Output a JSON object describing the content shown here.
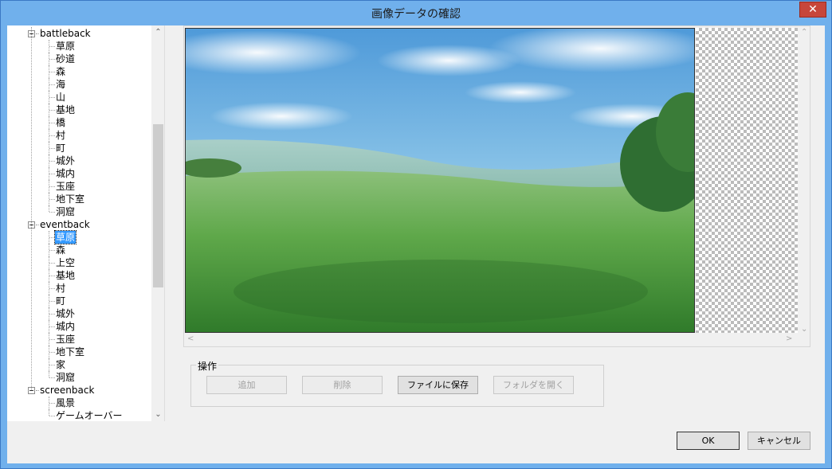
{
  "window": {
    "title": "画像データの確認",
    "close_glyph": "✕"
  },
  "tree": {
    "groups": [
      {
        "label": "battleback",
        "children": [
          "草原",
          "砂道",
          "森",
          "海",
          "山",
          "基地",
          "橋",
          "村",
          "町",
          "城外",
          "城内",
          "玉座",
          "地下室",
          "洞窟"
        ]
      },
      {
        "label": "eventback",
        "children": [
          "草原",
          "森",
          "上空",
          "基地",
          "村",
          "町",
          "城外",
          "城内",
          "玉座",
          "地下室",
          "家",
          "洞窟"
        ]
      },
      {
        "label": "screenback",
        "children": [
          "風景",
          "ゲームオーバー"
        ]
      }
    ],
    "selected": {
      "group": 1,
      "child": 0
    }
  },
  "operations": {
    "group_label": "操作",
    "add_label": "追加",
    "delete_label": "削除",
    "save_label": "ファイルに保存",
    "open_folder_label": "フォルダを開く"
  },
  "dialog": {
    "ok_label": "OK",
    "cancel_label": "キャンセル"
  },
  "icons": {
    "scroll_up": "▲",
    "scroll_down": "▼",
    "scroll_left": "<",
    "scroll_right": ">"
  },
  "colors": {
    "selection": "#3399ff",
    "title_bar": "#70b0ec",
    "close_button": "#c7463a"
  }
}
